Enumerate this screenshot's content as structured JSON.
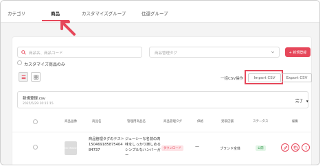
{
  "tabs": [
    {
      "label": "カテゴリ",
      "active": false
    },
    {
      "label": "商品",
      "active": true
    },
    {
      "label": "カスタマイズグループ",
      "active": false
    },
    {
      "label": "住還グループ",
      "active": false
    }
  ],
  "filters": {
    "search_placeholder": "商品名、商品コード",
    "tag_placeholder": "商品管理タグ",
    "new_button": "+ 新規登録",
    "custom_only_label": "カスタマイズ商品のみ"
  },
  "toolbar": {
    "bulk_label": "一括CSV操作",
    "import_label": "Import CSV",
    "export_label": "Export CSV"
  },
  "upload": {
    "file_name": "新規登録.csv",
    "date": "2025/5/29 10:15:15",
    "status": "完了"
  },
  "table": {
    "headers": [
      "商品画像",
      "商品名",
      "管理用商品名",
      "商品管理タグ",
      "価格",
      "受取店舗",
      "ステータス",
      "編集"
    ],
    "rows": [
      {
        "image_label": "NO IMAGE",
        "name": "商品管理タグのテスト",
        "code": "150469185875404 84737",
        "description": "ジューシーな名前の肉味をしっかり楽しめるシンプルなハンバーガー",
        "tag": "ダウンロード",
        "price": "—",
        "delivery": "ブランド全体",
        "status": "公開"
      }
    ]
  },
  "colors": {
    "accent": "#e6475a",
    "status_green": "#2e9a4a"
  }
}
